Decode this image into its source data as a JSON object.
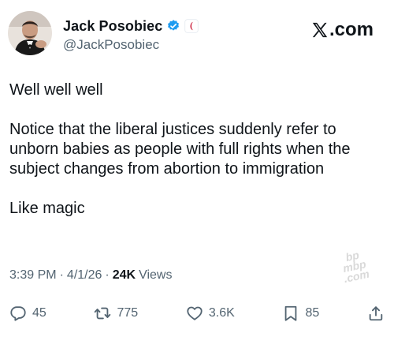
{
  "header": {
    "display_name": "Jack Posobiec",
    "handle": "@JackPosobiec",
    "site_label": ".com"
  },
  "tweet": {
    "paragraphs": [
      "Well well well",
      "Notice that the liberal justices suddenly refer to unborn babies as people with full rights when the subject changes from abortion to immigration",
      "Like magic"
    ]
  },
  "meta": {
    "time": "3:39 PM",
    "date": "4/1/26",
    "views_count": "24K",
    "views_label": "Views",
    "separator": "·"
  },
  "watermark": {
    "line1": "bp",
    "line2": "mbp",
    "line3": ".com"
  },
  "actions": {
    "replies": "45",
    "reposts": "775",
    "likes": "3.6K",
    "bookmarks": "85"
  },
  "colors": {
    "text": "#0f1419",
    "secondary": "#536471",
    "verified": "#1d9bf0"
  },
  "icons": [
    "verified-icon",
    "affiliate-icon",
    "x-logo-icon",
    "reply-icon",
    "repost-icon",
    "like-icon",
    "bookmark-icon",
    "share-icon"
  ]
}
